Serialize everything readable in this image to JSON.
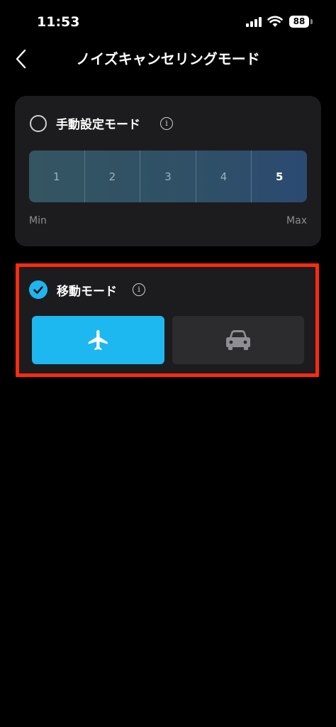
{
  "status_bar": {
    "time": "11:53",
    "battery": "88"
  },
  "header": {
    "title": "ノイズキャンセリングモード"
  },
  "manual_mode": {
    "label": "手動設定モード",
    "selected": false,
    "levels": [
      "1",
      "2",
      "3",
      "4",
      "5"
    ],
    "selected_level": "5",
    "min_label": "Min",
    "max_label": "Max"
  },
  "transport_mode": {
    "label": "移動モード",
    "selected": true,
    "options": [
      {
        "icon": "airplane-icon",
        "selected": true
      },
      {
        "icon": "car-icon",
        "selected": false
      }
    ]
  },
  "colors": {
    "accent": "#1eb8f0",
    "highlight": "#ff2a0f",
    "card": "#1c1c1e"
  }
}
